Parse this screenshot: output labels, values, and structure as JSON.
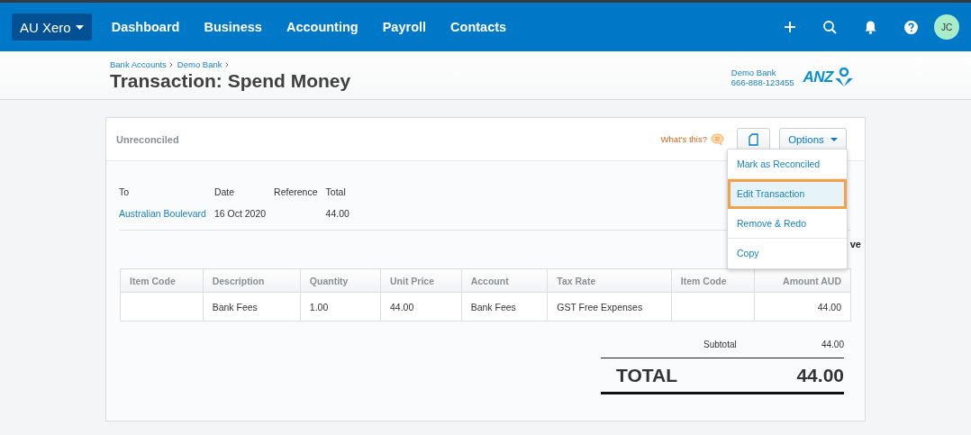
{
  "nav": {
    "org": "AU Xero",
    "items": [
      "Dashboard",
      "Business",
      "Accounting",
      "Payroll",
      "Contacts"
    ],
    "avatar": "JC"
  },
  "header": {
    "breadcrumbs": [
      "Bank Accounts",
      "Demo Bank"
    ],
    "title": "Transaction: Spend Money",
    "bank_name": "Demo Bank",
    "account_number": "666-888-123455",
    "bank_logo": "ANZ"
  },
  "card": {
    "status": "Unreconciled",
    "help_link": "What's this?",
    "options_button": "Options",
    "menu": [
      {
        "label": "Mark as Reconciled",
        "selected": false
      },
      {
        "label": "Edit Transaction",
        "selected": true
      },
      {
        "label": "Remove & Redo",
        "selected": false
      },
      {
        "label": "Copy",
        "selected": false
      }
    ],
    "summary": [
      {
        "kind": "link",
        "label": "To",
        "value": "Australian Boulevard"
      },
      {
        "kind": "text",
        "label": "Date",
        "value": "16 Oct 2020"
      },
      {
        "label": "Reference"
      },
      {
        "kind": "text",
        "label": "Total",
        "value": "44.00"
      }
    ],
    "hidden_text": "ve",
    "table": {
      "columns": [
        "Item Code",
        "Description",
        "Quantity",
        "Unit Price",
        "Account",
        "Tax Rate",
        "Item Code",
        "Amount AUD"
      ],
      "rows": [
        [
          "",
          "Bank Fees",
          "1.00",
          "44.00",
          "Bank Fees",
          "GST Free Expenses",
          "",
          "44.00"
        ]
      ]
    },
    "subtotal_label": "Subtotal",
    "subtotal": "44.00",
    "total_label": "TOTAL",
    "total": "44.00"
  }
}
